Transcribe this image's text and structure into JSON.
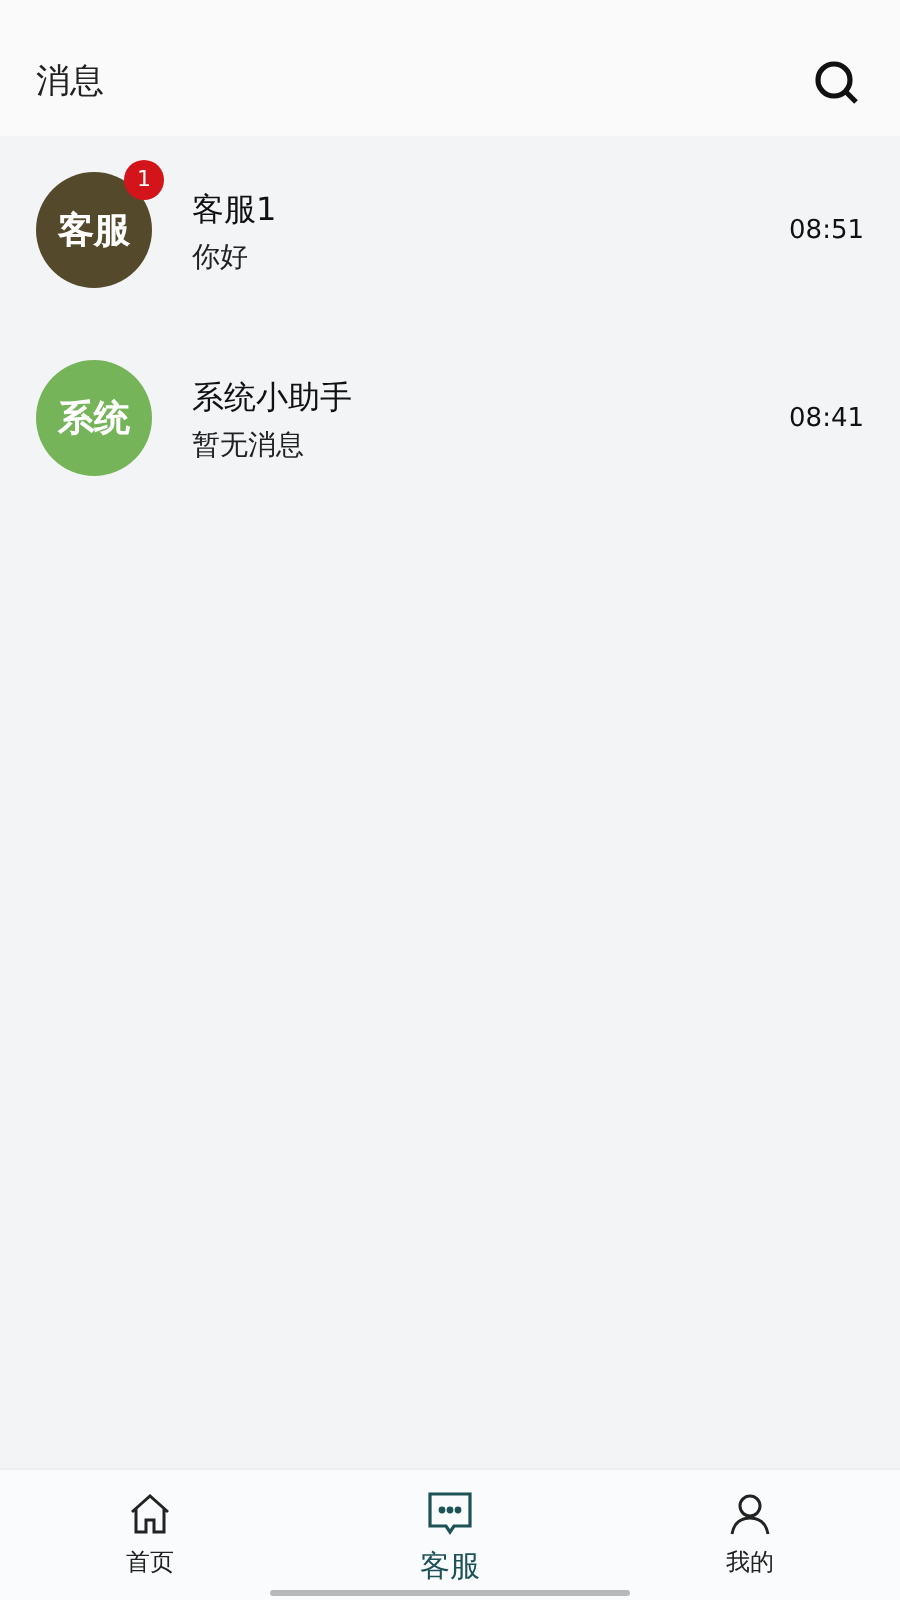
{
  "header": {
    "title": "消息"
  },
  "conversations": [
    {
      "avatar_text": "客服",
      "color": "#544a2b",
      "badge": "1",
      "name": "客服1",
      "preview": "你好",
      "time": "08:51"
    },
    {
      "avatar_text": "系统",
      "color": "#76b45a",
      "name": "系统小助手",
      "preview": "暂无消息",
      "time": "08:41"
    }
  ],
  "tabs": [
    {
      "kind": "home",
      "label": "首页",
      "selected": false
    },
    {
      "kind": "chat",
      "label": "客服",
      "selected": true
    },
    {
      "kind": "person",
      "label": "我的",
      "selected": false
    }
  ]
}
